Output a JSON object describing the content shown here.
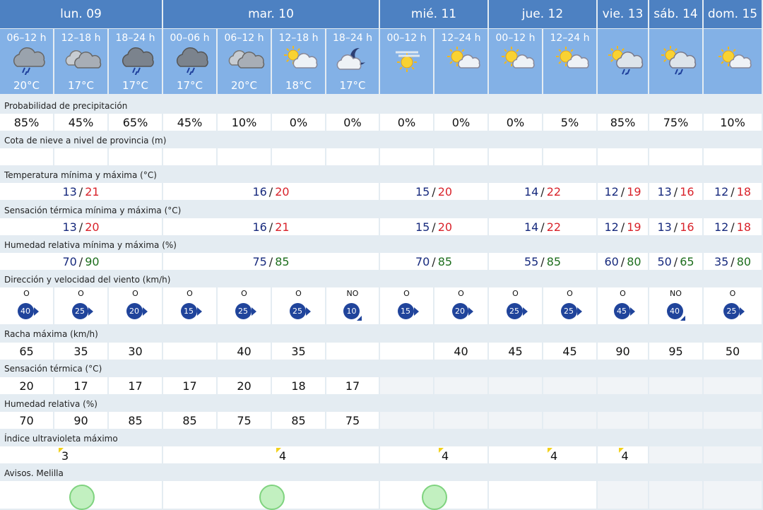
{
  "days": [
    "lun. 09",
    "mar. 10",
    "mié. 11",
    "jue. 12",
    "vie. 13",
    "sáb. 14",
    "dom. 15"
  ],
  "periods": [
    {
      "label": "06–12 h",
      "temp": "20°C",
      "icon": "rain-heavy-cloud-icon"
    },
    {
      "label": "12–18 h",
      "temp": "17°C",
      "icon": "cloudy-icon"
    },
    {
      "label": "18–24 h",
      "temp": "17°C",
      "icon": "rain-dark-cloud-icon"
    },
    {
      "label": "00–06 h",
      "temp": "17°C",
      "icon": "rain-dark-cloud-icon"
    },
    {
      "label": "06–12 h",
      "temp": "20°C",
      "icon": "cloudy-icon"
    },
    {
      "label": "12–18 h",
      "temp": "18°C",
      "icon": "sun-behind-cloud-icon"
    },
    {
      "label": "18–24 h",
      "temp": "17°C",
      "icon": "moon-cloud-icon"
    },
    {
      "label": "00–12 h",
      "temp": "",
      "icon": "sun-haze-icon"
    },
    {
      "label": "12–24 h",
      "temp": "",
      "icon": "sun-cloud-icon"
    },
    {
      "label": "00–12 h",
      "temp": "",
      "icon": "sun-cloud-icon"
    },
    {
      "label": "12–24 h",
      "temp": "",
      "icon": "sun-cloud-icon"
    },
    {
      "label": "",
      "temp": "",
      "icon": "sun-rain-cloud-icon"
    },
    {
      "label": "",
      "temp": "",
      "icon": "sun-rain-cloud-icon"
    },
    {
      "label": "",
      "temp": "",
      "icon": "sun-cloud-icon"
    }
  ],
  "labels": {
    "precip": "Probabilidad de precipitación",
    "snow": "Cota de nieve a nivel de provincia (m)",
    "temp": "Temperatura mínima y máxima (°C)",
    "sens": "Sensación térmica mínima y máxima (°C)",
    "hum": "Humedad relativa mínima y máxima (%)",
    "wind": "Dirección y velocidad del viento (km/h)",
    "gust": "Racha máxima (km/h)",
    "sens_t": "Sensación térmica (°C)",
    "hum_r": "Humedad relativa (%)",
    "uv": "Índice ultravioleta máximo",
    "avisos": "Avisos. Melilla"
  },
  "precip": [
    "85%",
    "45%",
    "65%",
    "45%",
    "10%",
    "0%",
    "0%",
    "0%",
    "0%",
    "0%",
    "5%",
    "85%",
    "75%",
    "10%"
  ],
  "minmax_temp": [
    {
      "min": "13",
      "max": "21"
    },
    {
      "min": "16",
      "max": "20"
    },
    {
      "min": "15",
      "max": "20"
    },
    {
      "min": "14",
      "max": "22"
    },
    {
      "min": "12",
      "max": "19"
    },
    {
      "min": "13",
      "max": "16"
    },
    {
      "min": "12",
      "max": "18"
    }
  ],
  "minmax_sens": [
    {
      "min": "13",
      "max": "20"
    },
    {
      "min": "16",
      "max": "21"
    },
    {
      "min": "15",
      "max": "20"
    },
    {
      "min": "14",
      "max": "22"
    },
    {
      "min": "12",
      "max": "19"
    },
    {
      "min": "13",
      "max": "16"
    },
    {
      "min": "12",
      "max": "18"
    }
  ],
  "minmax_hum": [
    {
      "min": "70",
      "max": "90"
    },
    {
      "min": "75",
      "max": "85"
    },
    {
      "min": "70",
      "max": "85"
    },
    {
      "min": "55",
      "max": "85"
    },
    {
      "min": "60",
      "max": "80"
    },
    {
      "min": "50",
      "max": "65"
    },
    {
      "min": "35",
      "max": "80"
    }
  ],
  "wind": [
    {
      "dir": "O",
      "speed": "40"
    },
    {
      "dir": "O",
      "speed": "25"
    },
    {
      "dir": "O",
      "speed": "20"
    },
    {
      "dir": "O",
      "speed": "15"
    },
    {
      "dir": "O",
      "speed": "25"
    },
    {
      "dir": "O",
      "speed": "25"
    },
    {
      "dir": "NO",
      "speed": "10"
    },
    {
      "dir": "O",
      "speed": "15"
    },
    {
      "dir": "O",
      "speed": "20"
    },
    {
      "dir": "O",
      "speed": "25"
    },
    {
      "dir": "O",
      "speed": "25"
    },
    {
      "dir": "O",
      "speed": "45"
    },
    {
      "dir": "NO",
      "speed": "40"
    },
    {
      "dir": "O",
      "speed": "25"
    }
  ],
  "gust": [
    "65",
    "35",
    "30",
    "",
    "40",
    "35",
    "",
    "",
    "40",
    "45",
    "45",
    "90",
    "95",
    "50"
  ],
  "sens_t": [
    "20",
    "17",
    "17",
    "17",
    "20",
    "18",
    "17",
    "",
    "",
    "",
    "",
    "",
    "",
    ""
  ],
  "hum_r": [
    "70",
    "90",
    "85",
    "85",
    "75",
    "85",
    "75",
    "",
    "",
    "",
    "",
    "",
    "",
    ""
  ],
  "uv": [
    "3",
    "4",
    "4",
    "4",
    "4",
    "",
    ""
  ],
  "colors": {
    "day_header": "#4d81c2",
    "period_header": "#83b1e6",
    "min": "#172a7d",
    "max": "#d9232b",
    "hum_max": "#1d6e1d",
    "wind_badge": "#20449b",
    "aviso_green": "#c2f0c0"
  }
}
